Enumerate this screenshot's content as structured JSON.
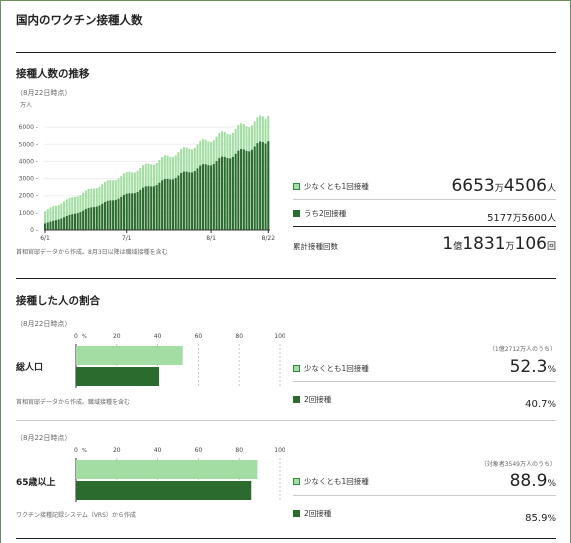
{
  "page_title": "国内のワクチン接種人数",
  "trend": {
    "heading": "接種人数の推移",
    "date_note": "（8月22日時点）",
    "y_unit": "万人",
    "source": "首相官邸データから作成。8月3日以降は職域接種を含む",
    "stats": {
      "row1": {
        "label": "少なくとも1回接種",
        "v1": "6653",
        "u1": "万",
        "v2": "4506",
        "u2": "人"
      },
      "row2": {
        "label": "うち2回接種",
        "v1": "5177",
        "u1": "万",
        "v2": "5600",
        "u2": "人"
      },
      "row3": {
        "label": "累計接種回数",
        "v1": "1",
        "u1": "億",
        "v2": "1831",
        "u2": "万",
        "v3": "106",
        "u3": "回"
      }
    }
  },
  "chart_data": {
    "type": "bar",
    "title": "",
    "ylabel": "万人",
    "x_tick_labels": [
      "6/1",
      "7/1",
      "8/1",
      "8/22"
    ],
    "y_ticks": [
      "6000",
      "5000",
      "4000",
      "3000",
      "2000",
      "1000",
      "0"
    ],
    "ylim": [
      0,
      7000
    ],
    "n_days": 83,
    "series": [
      {
        "name": "少なくとも1回接種",
        "color": "#a3dda4",
        "start": 1100,
        "end": 6653
      },
      {
        "name": "うち2回接種",
        "color": "#2b6b2e",
        "start": 380,
        "end": 5178
      }
    ]
  },
  "ratio": {
    "heading": "接種した人の割合",
    "axis": [
      "0",
      "20",
      "40",
      "60",
      "80",
      "100"
    ],
    "axis_pct": "%",
    "blocks": [
      {
        "date_note": "（8月22日時点）",
        "row_label": "総人口",
        "source": "首相官邸データから作成。職域接種を含む",
        "base_note": "（1億2712万人のうち）",
        "one_dose_label": "少なくとも1回接種",
        "one_dose_value": "52.3",
        "two_dose_label": "2回接種",
        "two_dose_value": "40.7",
        "pct": "%",
        "one_fraction": 0.523,
        "two_fraction": 0.407
      },
      {
        "date_note": "（8月22日時点）",
        "row_label": "65歳以上",
        "source": "ワクチン接種記録システム（VRS）から作成",
        "base_note": "（対象者3549万人のうち）",
        "one_dose_label": "少なくとも1回接種",
        "one_dose_value": "88.9",
        "two_dose_label": "2回接種",
        "two_dose_value": "85.9",
        "pct": "%",
        "one_fraction": 0.889,
        "two_fraction": 0.859
      }
    ]
  },
  "colors": {
    "light": "#a3dda4",
    "dark": "#2b6b2e"
  }
}
